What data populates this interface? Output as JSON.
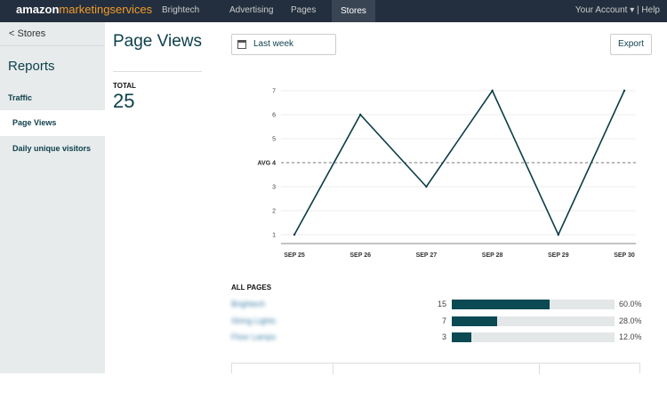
{
  "topnav": {
    "logo_main": "amazon",
    "logo_sub": "marketingservices",
    "tabs": [
      {
        "label": "Brightech",
        "active": false
      },
      {
        "label": "Advertising",
        "active": false
      },
      {
        "label": "Pages",
        "active": false
      },
      {
        "label": "Stores",
        "active": true
      }
    ],
    "account": "Your Account",
    "help": "Help"
  },
  "sidebar": {
    "back": "< Stores",
    "title": "Reports",
    "section": "Traffic",
    "items": [
      {
        "label": "Page Views",
        "active": true
      },
      {
        "label": "Daily unique visitors",
        "active": false
      }
    ]
  },
  "main": {
    "title": "Page Views",
    "total_label": "TOTAL",
    "total_value": "25",
    "date_range": "Last week",
    "export": "Export"
  },
  "chart_data": {
    "type": "line",
    "categories": [
      "SEP 25",
      "SEP 26",
      "SEP 27",
      "SEP 28",
      "SEP 29",
      "SEP 30"
    ],
    "values": [
      1,
      6,
      3,
      7,
      1,
      7
    ],
    "ylim": [
      1,
      7
    ],
    "yticks": [
      "1",
      "2",
      "3",
      "4",
      "5",
      "6",
      "7"
    ],
    "avg_label": "AVG 4",
    "avg_value": 4,
    "grid": true,
    "line_color": "#0b3d45"
  },
  "pages": {
    "label": "ALL PAGES",
    "rows": [
      {
        "name": "Brightech",
        "count": "15",
        "pct": "60.0%",
        "fraction": 0.6
      },
      {
        "name": "String Lights",
        "count": "7",
        "pct": "28.0%",
        "fraction": 0.28
      },
      {
        "name": "Floor Lamps",
        "count": "3",
        "pct": "12.0%",
        "fraction": 0.12
      }
    ]
  }
}
